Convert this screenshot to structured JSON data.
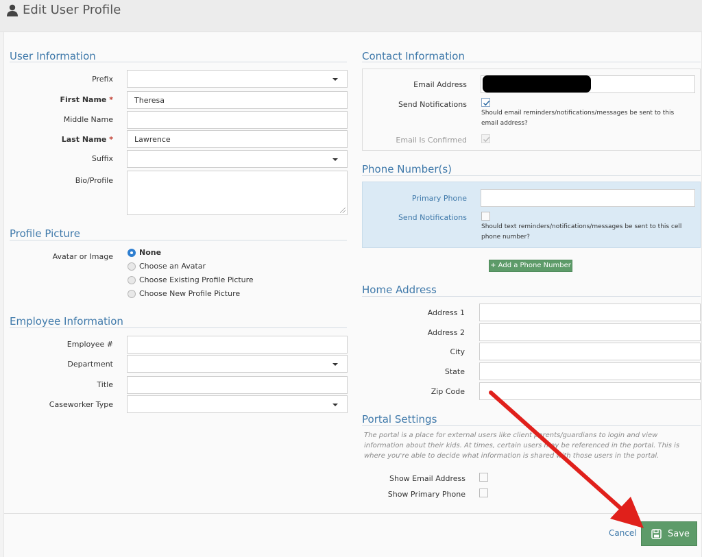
{
  "header": {
    "title": "Edit User Profile"
  },
  "user_information": {
    "section_title": "User Information",
    "prefix": {
      "label": "Prefix",
      "value": ""
    },
    "first_name": {
      "label": "First Name",
      "required_mark": "*",
      "value": "Theresa"
    },
    "middle_name": {
      "label": "Middle Name",
      "value": ""
    },
    "last_name": {
      "label": "Last Name",
      "required_mark": "*",
      "value": "Lawrence"
    },
    "suffix": {
      "label": "Suffix",
      "value": ""
    },
    "bio": {
      "label": "Bio/Profile",
      "value": ""
    }
  },
  "profile_picture": {
    "section_title": "Profile Picture",
    "label": "Avatar or Image",
    "options": [
      "None",
      "Choose an Avatar",
      "Choose Existing Profile Picture",
      "Choose New Profile Picture"
    ],
    "selected": "None"
  },
  "employee_information": {
    "section_title": "Employee Information",
    "employee_number": {
      "label": "Employee #",
      "value": ""
    },
    "department": {
      "label": "Department",
      "value": ""
    },
    "title": {
      "label": "Title",
      "value": ""
    },
    "caseworker_type": {
      "label": "Caseworker Type",
      "value": ""
    }
  },
  "contact_information": {
    "section_title": "Contact Information",
    "email": {
      "label": "Email Address"
    },
    "send_notifications": {
      "label": "Send Notifications",
      "checked": true,
      "help": "Should email reminders/notifications/messages be sent to this email address?"
    },
    "email_confirmed": {
      "label": "Email Is Confirmed",
      "checked": true
    }
  },
  "phone_numbers": {
    "section_title": "Phone Number(s)",
    "primary_phone": {
      "label": "Primary Phone",
      "value": ""
    },
    "send_notifications": {
      "label": "Send Notifications",
      "checked": false,
      "help": "Should text reminders/notifications/messages be sent to this cell phone number?"
    },
    "add_button": "+ Add a Phone Number"
  },
  "home_address": {
    "section_title": "Home Address",
    "address1": {
      "label": "Address 1",
      "value": ""
    },
    "address2": {
      "label": "Address 2",
      "value": ""
    },
    "city": {
      "label": "City",
      "value": ""
    },
    "state": {
      "label": "State",
      "value": ""
    },
    "zip": {
      "label": "Zip Code",
      "value": ""
    }
  },
  "portal_settings": {
    "section_title": "Portal Settings",
    "description": "The portal is a place for external users like client parents/guardians to login and view information about their kids. At times, certain users may be referenced in the portal. This is where you're able to decide what information is shared with those users in the portal.",
    "show_email": {
      "label": "Show Email Address",
      "checked": false
    },
    "show_phone": {
      "label": "Show Primary Phone",
      "checked": false
    }
  },
  "footer": {
    "cancel_label": "Cancel",
    "save_label": "Save"
  },
  "colors": {
    "accent": "#3f79aa",
    "save_green": "#5d9b69",
    "required": "#c0392b",
    "annotation_arrow": "#e0201b"
  },
  "icons": [
    "user-icon",
    "dropdown-caret-icon",
    "checkmark-icon",
    "plus-icon",
    "save-floppy-icon",
    "resize-grip-icon"
  ]
}
